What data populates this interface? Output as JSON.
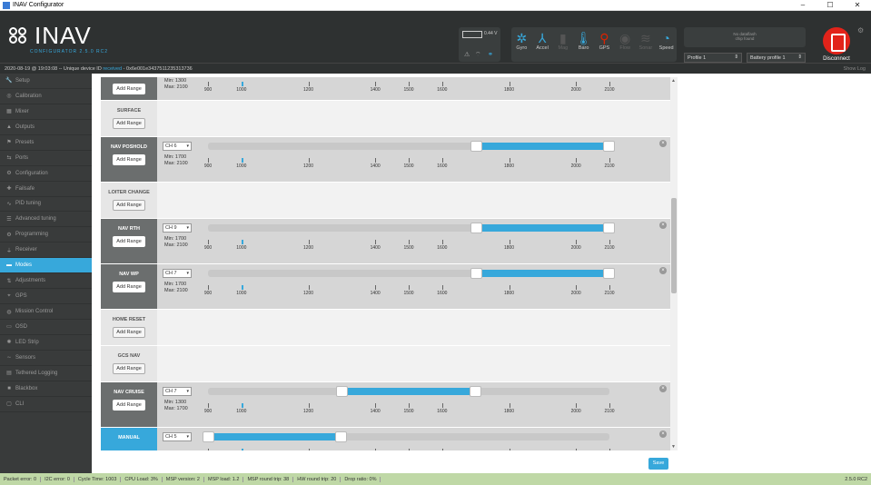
{
  "window": {
    "title": "INAV Configurator",
    "controls": [
      "–",
      "☐",
      "✕"
    ]
  },
  "logo": {
    "text": "INAV",
    "sub": "CONFIGURATOR  2.5.0 RC2"
  },
  "battery": {
    "voltage": "0.44 V"
  },
  "sensors": [
    {
      "name": "Gyro",
      "icon": "gyro-icon",
      "glyph": "✲",
      "state": "on"
    },
    {
      "name": "Accel",
      "icon": "accel-icon",
      "glyph": "⅄",
      "state": "on"
    },
    {
      "name": "Mag",
      "icon": "mag-icon",
      "glyph": "▮",
      "state": "off"
    },
    {
      "name": "Baro",
      "icon": "baro-icon",
      "glyph": "🌡",
      "state": "on"
    },
    {
      "name": "GPS",
      "icon": "gps-icon",
      "glyph": "⚲",
      "state": "err"
    },
    {
      "name": "Flow",
      "icon": "flow-icon",
      "glyph": "◉",
      "state": "off"
    },
    {
      "name": "Sonar",
      "icon": "sonar-icon",
      "glyph": "≋",
      "state": "off"
    },
    {
      "name": "Speed",
      "icon": "speed-icon",
      "glyph": "◔",
      "state": "on"
    }
  ],
  "dataflash": {
    "line1": "No dataflash",
    "line2": "chip found"
  },
  "profiles": {
    "profile": "Profile 1",
    "battery_profile": "Battery profile 1"
  },
  "disconnect_label": "Disconnect",
  "infobar": {
    "prefix": "2020-08-19 @ 19:03:08 -- Unique device ID",
    "received": "received",
    "id": "- 0x6e001e3437511235313736",
    "show_log": "Show Log"
  },
  "sidebar": [
    {
      "label": "Setup",
      "icon": "wrench-icon",
      "glyph": "🔧"
    },
    {
      "label": "Calibration",
      "icon": "calibration-icon",
      "glyph": "◎"
    },
    {
      "label": "Mixer",
      "icon": "mixer-icon",
      "glyph": "▦"
    },
    {
      "label": "Outputs",
      "icon": "outputs-icon",
      "glyph": "▲"
    },
    {
      "label": "Presets",
      "icon": "presets-icon",
      "glyph": "⚑"
    },
    {
      "label": "Ports",
      "icon": "ports-icon",
      "glyph": "⇆"
    },
    {
      "label": "Configuration",
      "icon": "gear-icon",
      "glyph": "⚙"
    },
    {
      "label": "Failsafe",
      "icon": "failsafe-icon",
      "glyph": "✚"
    },
    {
      "label": "PID tuning",
      "icon": "pid-icon",
      "glyph": "∿"
    },
    {
      "label": "Advanced tuning",
      "icon": "advanced-icon",
      "glyph": "☰"
    },
    {
      "label": "Programming",
      "icon": "programming-icon",
      "glyph": "⚙"
    },
    {
      "label": "Receiver",
      "icon": "receiver-icon",
      "glyph": "⏚"
    },
    {
      "label": "Modes",
      "icon": "modes-icon",
      "glyph": "▬",
      "active": true
    },
    {
      "label": "Adjustments",
      "icon": "adjustments-icon",
      "glyph": "⇅"
    },
    {
      "label": "GPS",
      "icon": "gps-icon",
      "glyph": "⌖"
    },
    {
      "label": "Mission Control",
      "icon": "mission-icon",
      "glyph": "◍"
    },
    {
      "label": "OSD",
      "icon": "osd-icon",
      "glyph": "▭"
    },
    {
      "label": "LED Strip",
      "icon": "led-icon",
      "glyph": "✺"
    },
    {
      "label": "Sensors",
      "icon": "sensors-icon",
      "glyph": "∼"
    },
    {
      "label": "Tethered Logging",
      "icon": "tethered-icon",
      "glyph": "▤"
    },
    {
      "label": "Blackbox",
      "icon": "blackbox-icon",
      "glyph": "■"
    },
    {
      "label": "CLI",
      "icon": "cli-icon",
      "glyph": "▢"
    }
  ],
  "scale_ticks": [
    "900",
    "1000",
    "1200",
    "1400",
    "1500",
    "1600",
    "1800",
    "2000",
    "2100"
  ],
  "add_range_label": "Add Range",
  "modes": [
    {
      "name": "",
      "style": "dark",
      "height": 26,
      "partial": true,
      "min": "1300",
      "max": "2100",
      "marker": 1000
    },
    {
      "name": "SURFACE",
      "style": "plain",
      "height": 40
    },
    {
      "name": "NAV POSHOLD",
      "style": "dark",
      "height": 50,
      "channel": "CH 6",
      "start": 1700,
      "end": 2100,
      "min": "1700",
      "max": "2100",
      "marker": 1000
    },
    {
      "name": "LOITER CHANGE",
      "style": "plain",
      "height": 40
    },
    {
      "name": "NAV RTH",
      "style": "dark",
      "height": 50,
      "channel": "CH 9",
      "start": 1700,
      "end": 2100,
      "min": "1700",
      "max": "2100",
      "marker": 1000
    },
    {
      "name": "NAV WP",
      "style": "dark",
      "height": 50,
      "channel": "CH 7",
      "start": 1700,
      "end": 2100,
      "min": "1700",
      "max": "2100",
      "marker": 1000
    },
    {
      "name": "HOME RESET",
      "style": "plain",
      "height": 40
    },
    {
      "name": "GCS NAV",
      "style": "plain",
      "height": 40
    },
    {
      "name": "NAV CRUISE",
      "style": "dark",
      "height": 50,
      "channel": "CH 7",
      "start": 1300,
      "end": 1700,
      "min": "1300",
      "max": "1700",
      "marker": 1000
    },
    {
      "name": "MANUAL",
      "style": "highlight",
      "height": 30,
      "channel": "CH 5",
      "start": 900,
      "end": 1300,
      "marker": 1000
    }
  ],
  "save_label": "Save",
  "status": [
    "Packet error: 0",
    "I2C error: 0",
    "Cycle Time: 1003",
    "CPU Load: 3%",
    "MSP version: 2",
    "MSP load: 1.2",
    "MSP round trip: 38",
    "HW round trip: 20",
    "Drop ratio: 0%"
  ],
  "version": "2.5.0 RC2"
}
